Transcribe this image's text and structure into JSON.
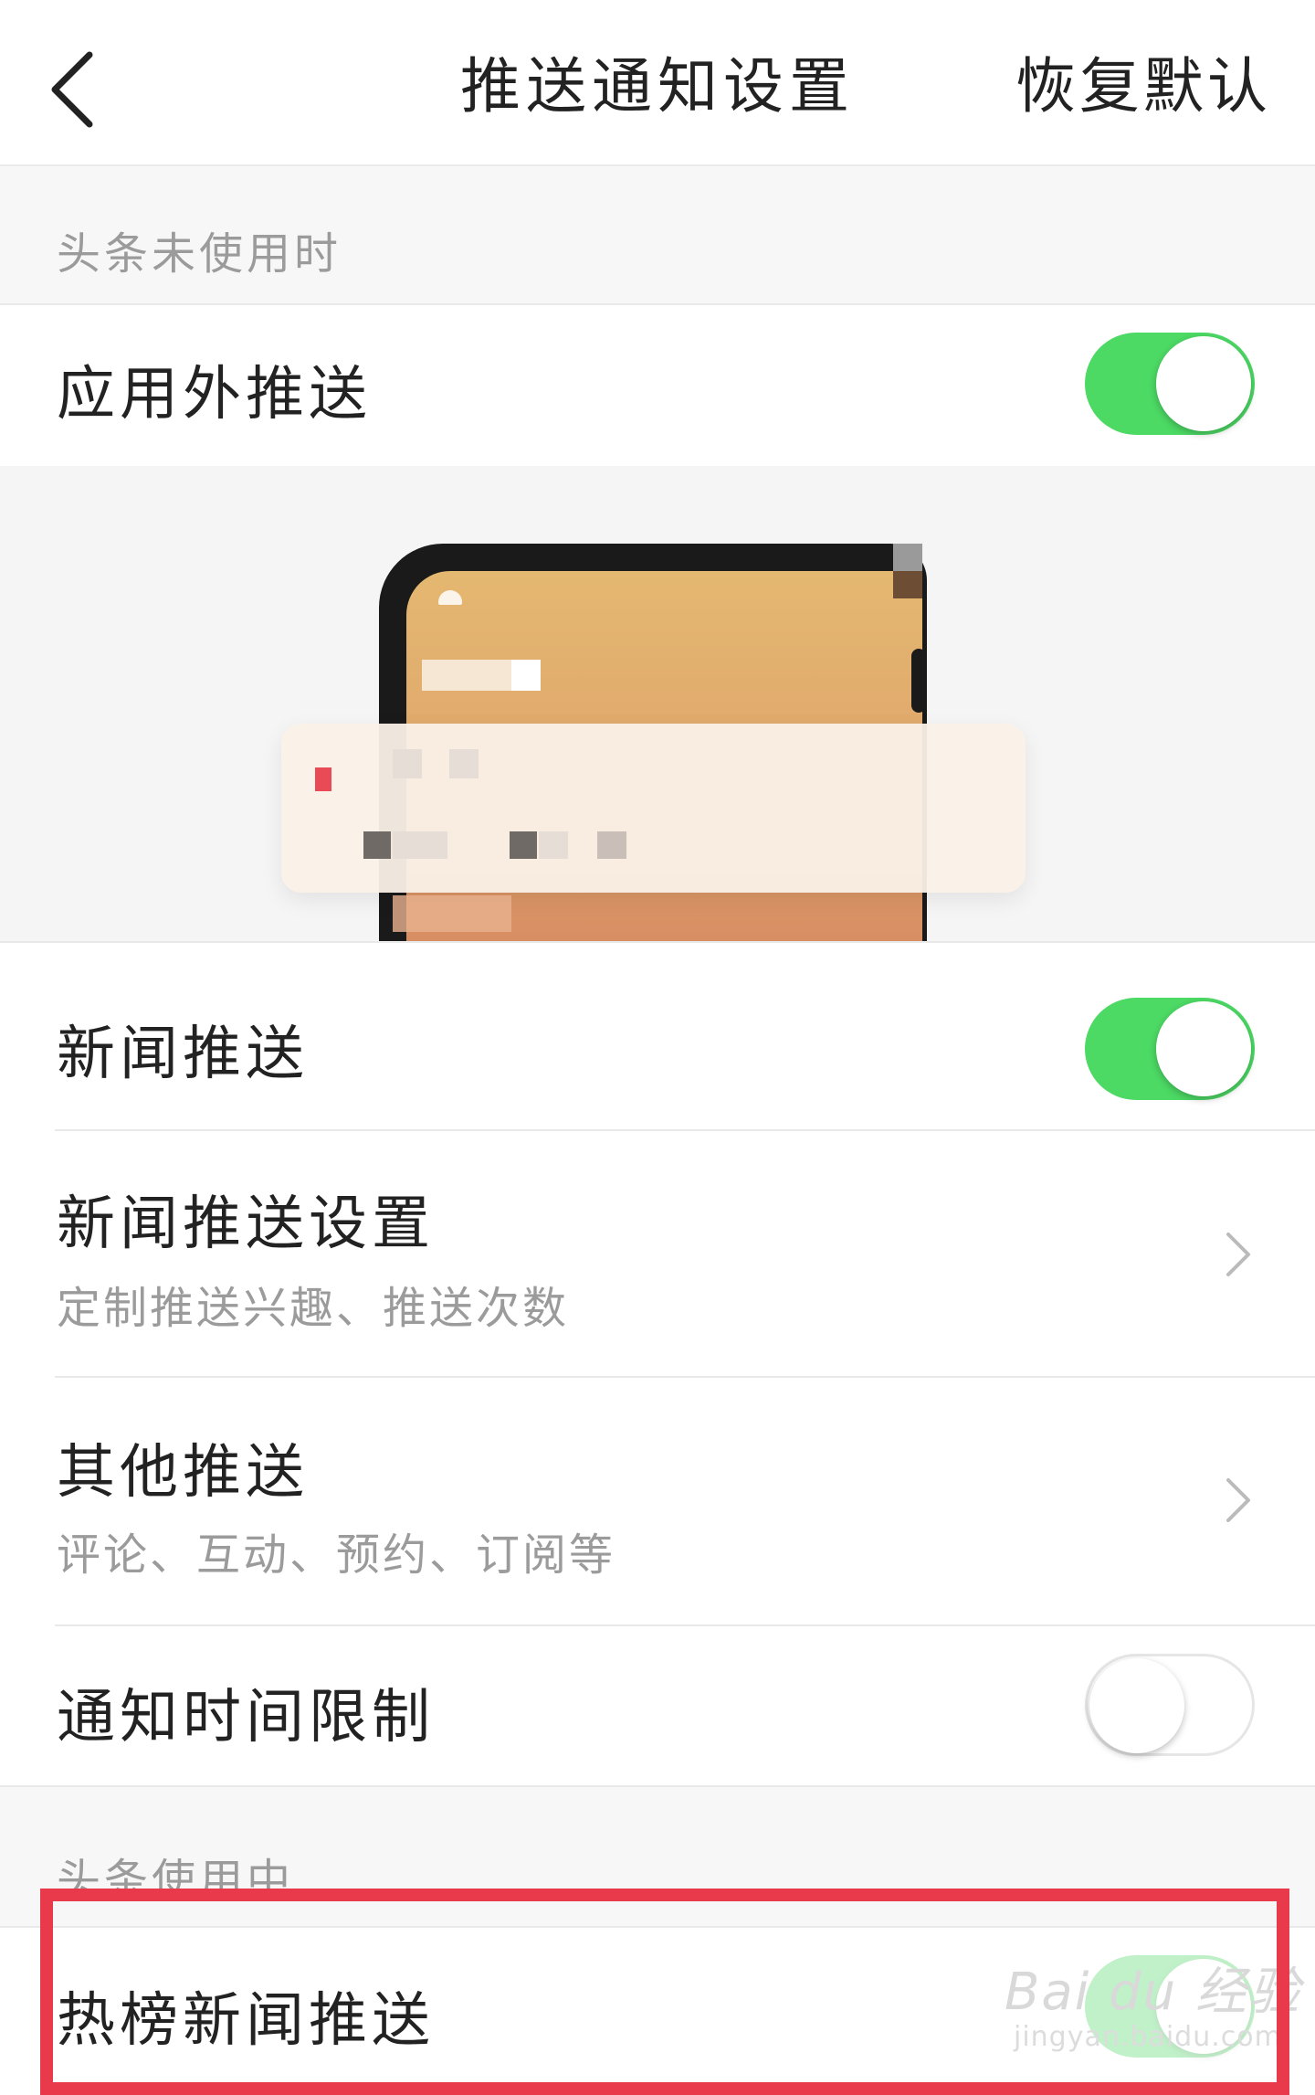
{
  "header": {
    "title": "推送通知设置",
    "reset_label": "恢复默认"
  },
  "section_inactive": {
    "label": "头条未使用时"
  },
  "rows": {
    "external_push": {
      "title": "应用外推送",
      "toggle": "on"
    },
    "news_push": {
      "title": "新闻推送",
      "toggle": "on"
    },
    "news_push_settings": {
      "title": "新闻推送设置",
      "subtitle": "定制推送兴趣、推送次数"
    },
    "other_push": {
      "title": "其他推送",
      "subtitle": "评论、互动、预约、订阅等"
    },
    "time_limit": {
      "title": "通知时间限制",
      "toggle": "off"
    }
  },
  "section_active": {
    "label": "头条使用中"
  },
  "hot_news_push": {
    "title": "热榜新闻推送",
    "toggle": "on"
  },
  "watermark": {
    "brand": "Bai du 经验",
    "url": "jingyan.baidu.com"
  },
  "colors": {
    "toggle_on": "#4cd964",
    "highlight": "#e83a4a",
    "secondary_text": "#9b9b9b"
  }
}
